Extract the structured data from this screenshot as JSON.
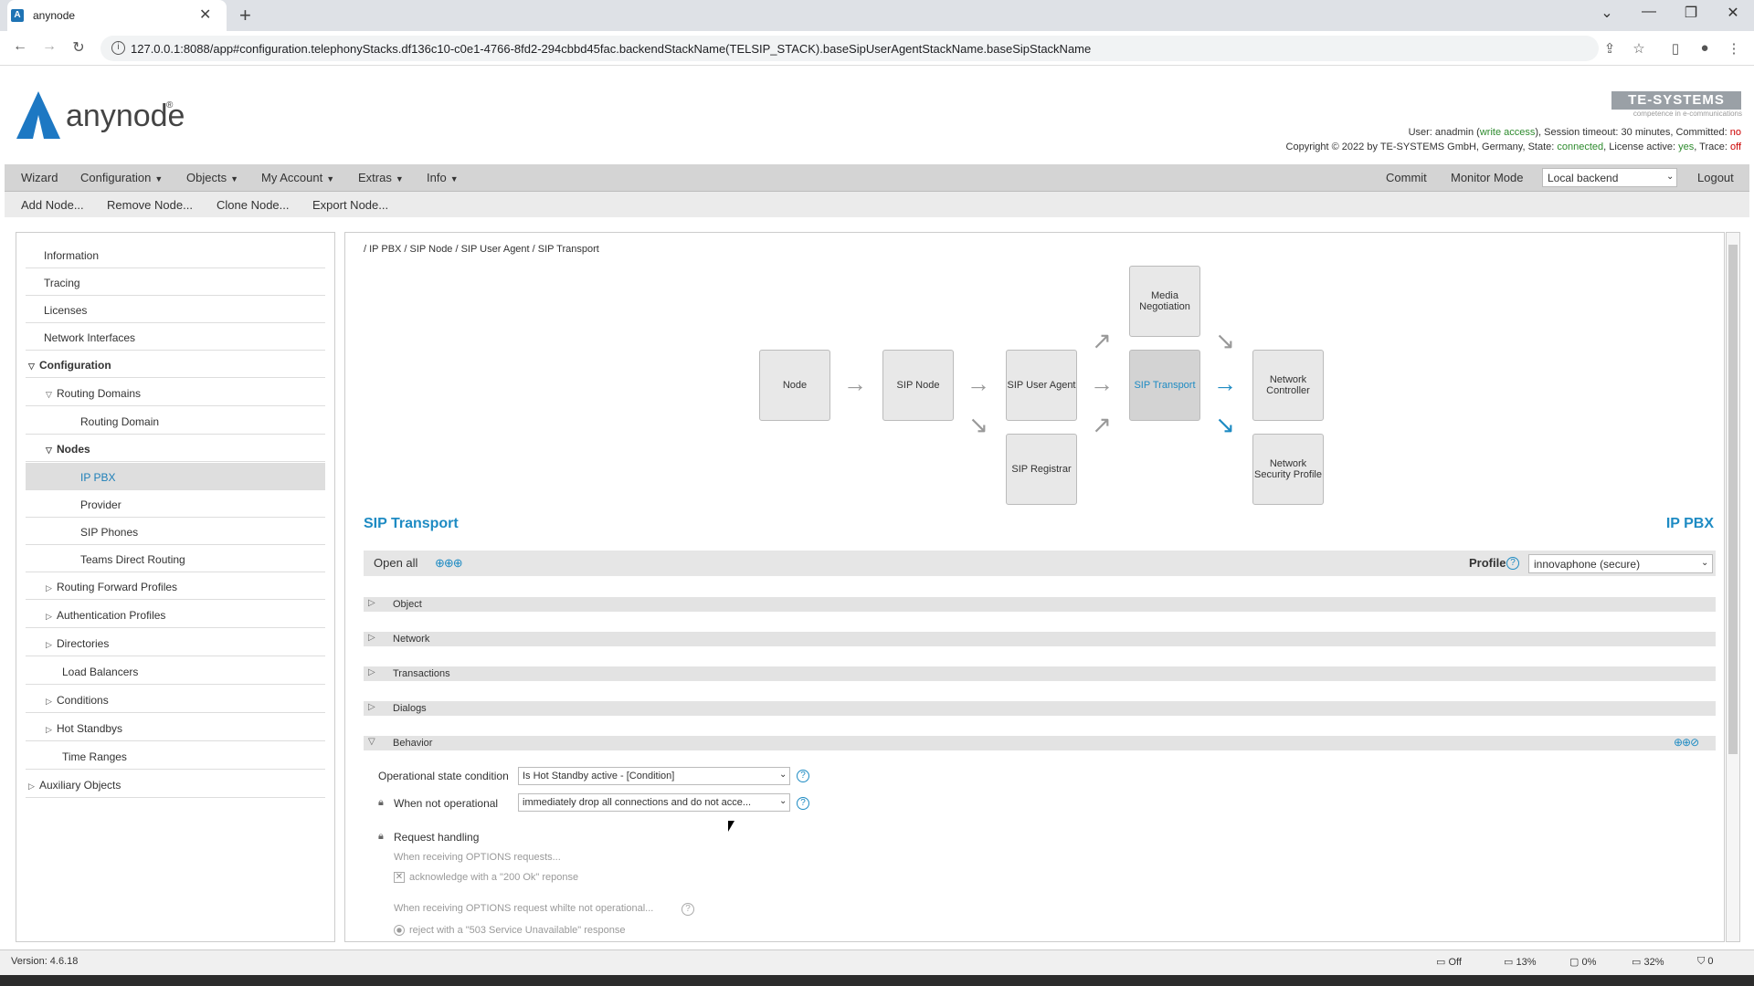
{
  "browser": {
    "tab_title": "anynode",
    "tab_favicon": "A",
    "url": "127.0.0.1:8088/app#configuration.telephonyStacks.df136c10-c0e1-4766-8fd2-294cbbd45fac.backendStackName(TELSIP_STACK).baseSipUserAgentStackName.baseSipStackName"
  },
  "header": {
    "logo_text": "anynode",
    "logo_reg": "®",
    "te_logo": "TE-SYSTEMS",
    "te_sub": "competence in e-communications",
    "user_prefix": "User: anadmin (",
    "user_access": "write access",
    "user_mid": "), Session timeout: 30 minutes, Committed:",
    "user_committed": "no",
    "copy_prefix": "Copyright © 2022 by TE-SYSTEMS GmbH, Germany, State:",
    "copy_state": "connected",
    "copy_mid": ", License active:",
    "copy_license": "yes",
    "copy_trace_lbl": ", Trace:",
    "copy_trace": "off"
  },
  "menu": {
    "wizard": "Wizard",
    "configuration": "Configuration",
    "objects": "Objects",
    "my_account": "My Account",
    "extras": "Extras",
    "info": "Info",
    "commit": "Commit",
    "monitor": "Monitor Mode",
    "backend": "Local backend",
    "logout": "Logout"
  },
  "submenu": {
    "add": "Add Node...",
    "remove": "Remove Node...",
    "clone": "Clone Node...",
    "export": "Export Node..."
  },
  "sidebar": [
    {
      "label": "Information"
    },
    {
      "label": "Tracing"
    },
    {
      "label": "Licenses"
    },
    {
      "label": "Network Interfaces"
    },
    {
      "label": "Configuration"
    },
    {
      "label": "Routing Domains"
    },
    {
      "label": "Routing Domain"
    },
    {
      "label": "Nodes"
    },
    {
      "label": "IP PBX"
    },
    {
      "label": "Provider"
    },
    {
      "label": "SIP Phones"
    },
    {
      "label": "Teams Direct Routing"
    },
    {
      "label": "Routing Forward Profiles"
    },
    {
      "label": "Authentication Profiles"
    },
    {
      "label": "Directories"
    },
    {
      "label": "Load Balancers"
    },
    {
      "label": "Conditions"
    },
    {
      "label": "Hot Standbys"
    },
    {
      "label": "Time Ranges"
    },
    {
      "label": "Auxiliary Objects"
    }
  ],
  "breadcrumb": "/ IP PBX / SIP Node / SIP User Agent / SIP Transport",
  "diagram": {
    "node": "Node",
    "sip_node": "SIP Node",
    "sip_user_agent": "SIP User Agent",
    "sip_transport": "SIP Transport",
    "media_negotiation": "Media Negotiation",
    "sip_registrar": "SIP Registrar",
    "network_controller": "Network Controller",
    "network_security_profile": "Network Security Profile"
  },
  "section": {
    "title": "SIP Transport",
    "right": "IP PBX"
  },
  "toolbar": {
    "open_all": "Open all",
    "profile_label": "Profile",
    "profile_value": "innovaphone (secure)"
  },
  "groups": {
    "object": "Object",
    "network": "Network",
    "transactions": "Transactions",
    "dialogs": "Dialogs",
    "behavior": "Behavior"
  },
  "behavior": {
    "op_state_label": "Operational state condition",
    "op_state_value": "Is Hot Standby active - [Condition]",
    "not_op_label": "When not operational",
    "not_op_value": "immediately drop all connections and do not acce...",
    "request_handling": "Request handling",
    "options_heading": "When receiving OPTIONS requests...",
    "options_ack": "acknowledge with a \"200 Ok\" reponse",
    "options_not_op": "When receiving OPTIONS request whilte not operational...",
    "options_reject": "reject with a \"503 Service Unavailable\" response"
  },
  "status": {
    "version": "Version: 4.6.18",
    "s1": "Off",
    "s2": "13%",
    "s3": "0%",
    "s4": "32%",
    "s5": "0"
  }
}
